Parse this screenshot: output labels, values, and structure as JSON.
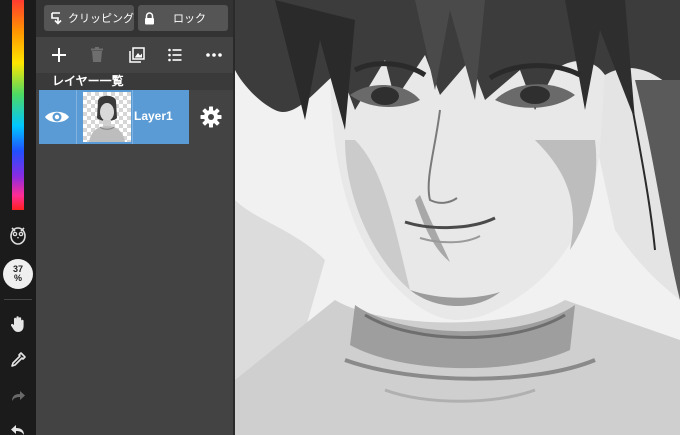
{
  "panel": {
    "clipping_label": "クリッピング",
    "lock_label": "ロック",
    "title": "レイヤー一覧"
  },
  "toolbar": {
    "icons": [
      "add-icon",
      "trash-icon",
      "duplicate-layer-icon",
      "list-icon",
      "more-icon"
    ]
  },
  "layers": [
    {
      "name": "Layer1",
      "visible": true,
      "selected": true
    }
  ],
  "zoom": {
    "value": "37",
    "unit": "%"
  },
  "colors": {
    "panel_bg": "#434343",
    "panel_top_bg": "#333333",
    "button_bg": "#555555",
    "selected_layer": "#5b9bd5",
    "tool_strip_bg": "#1b1b1b"
  }
}
